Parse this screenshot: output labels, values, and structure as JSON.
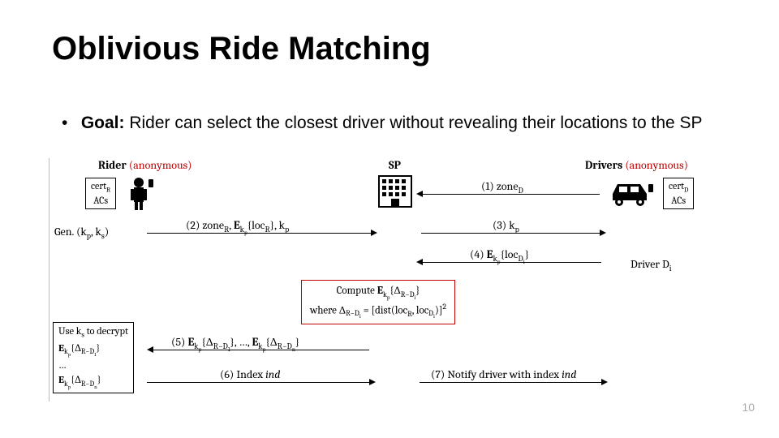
{
  "title": "Oblivious Ride Matching",
  "goal": {
    "label": "Goal:",
    "text": " Rider can select the closest driver without revealing their locations to the SP"
  },
  "roles": {
    "rider": "Rider",
    "rider_anon": " (anonymous)",
    "sp": "SP",
    "drivers": "Drivers",
    "drivers_anon": " (anonymous)"
  },
  "notes": {
    "rider_cert": "cert_R\nACs",
    "driver_cert": "cert_D\nACs",
    "gen": "Gen. (k_p, k_s)",
    "driver_i": "Driver D_i",
    "compute": "Compute E_kp{Δ_{R−D_i}}\nwhere Δ_{R−D_i} = [dist(loc_R, loc_{D_i})]²",
    "decrypt": "Use k_s to decrypt\nE_kp{Δ_{R−D₁}}\n…\nE_kp{Δ_{R−Dₙ}}"
  },
  "arrows": {
    "a1": "(1) zone_D",
    "a2": "(2) zone_R, E_kp{loc_R}, k_p",
    "a3": "(3) k_p",
    "a4": "(4) E_kp{loc_{D_i}}",
    "a5": "(5) E_kp{Δ_{R−D₁}}, …, E_kp{Δ_{R−Dₙ}}",
    "a6": "(6) Index ind",
    "a7": "(7) Notify driver with index ind"
  },
  "page": "10"
}
